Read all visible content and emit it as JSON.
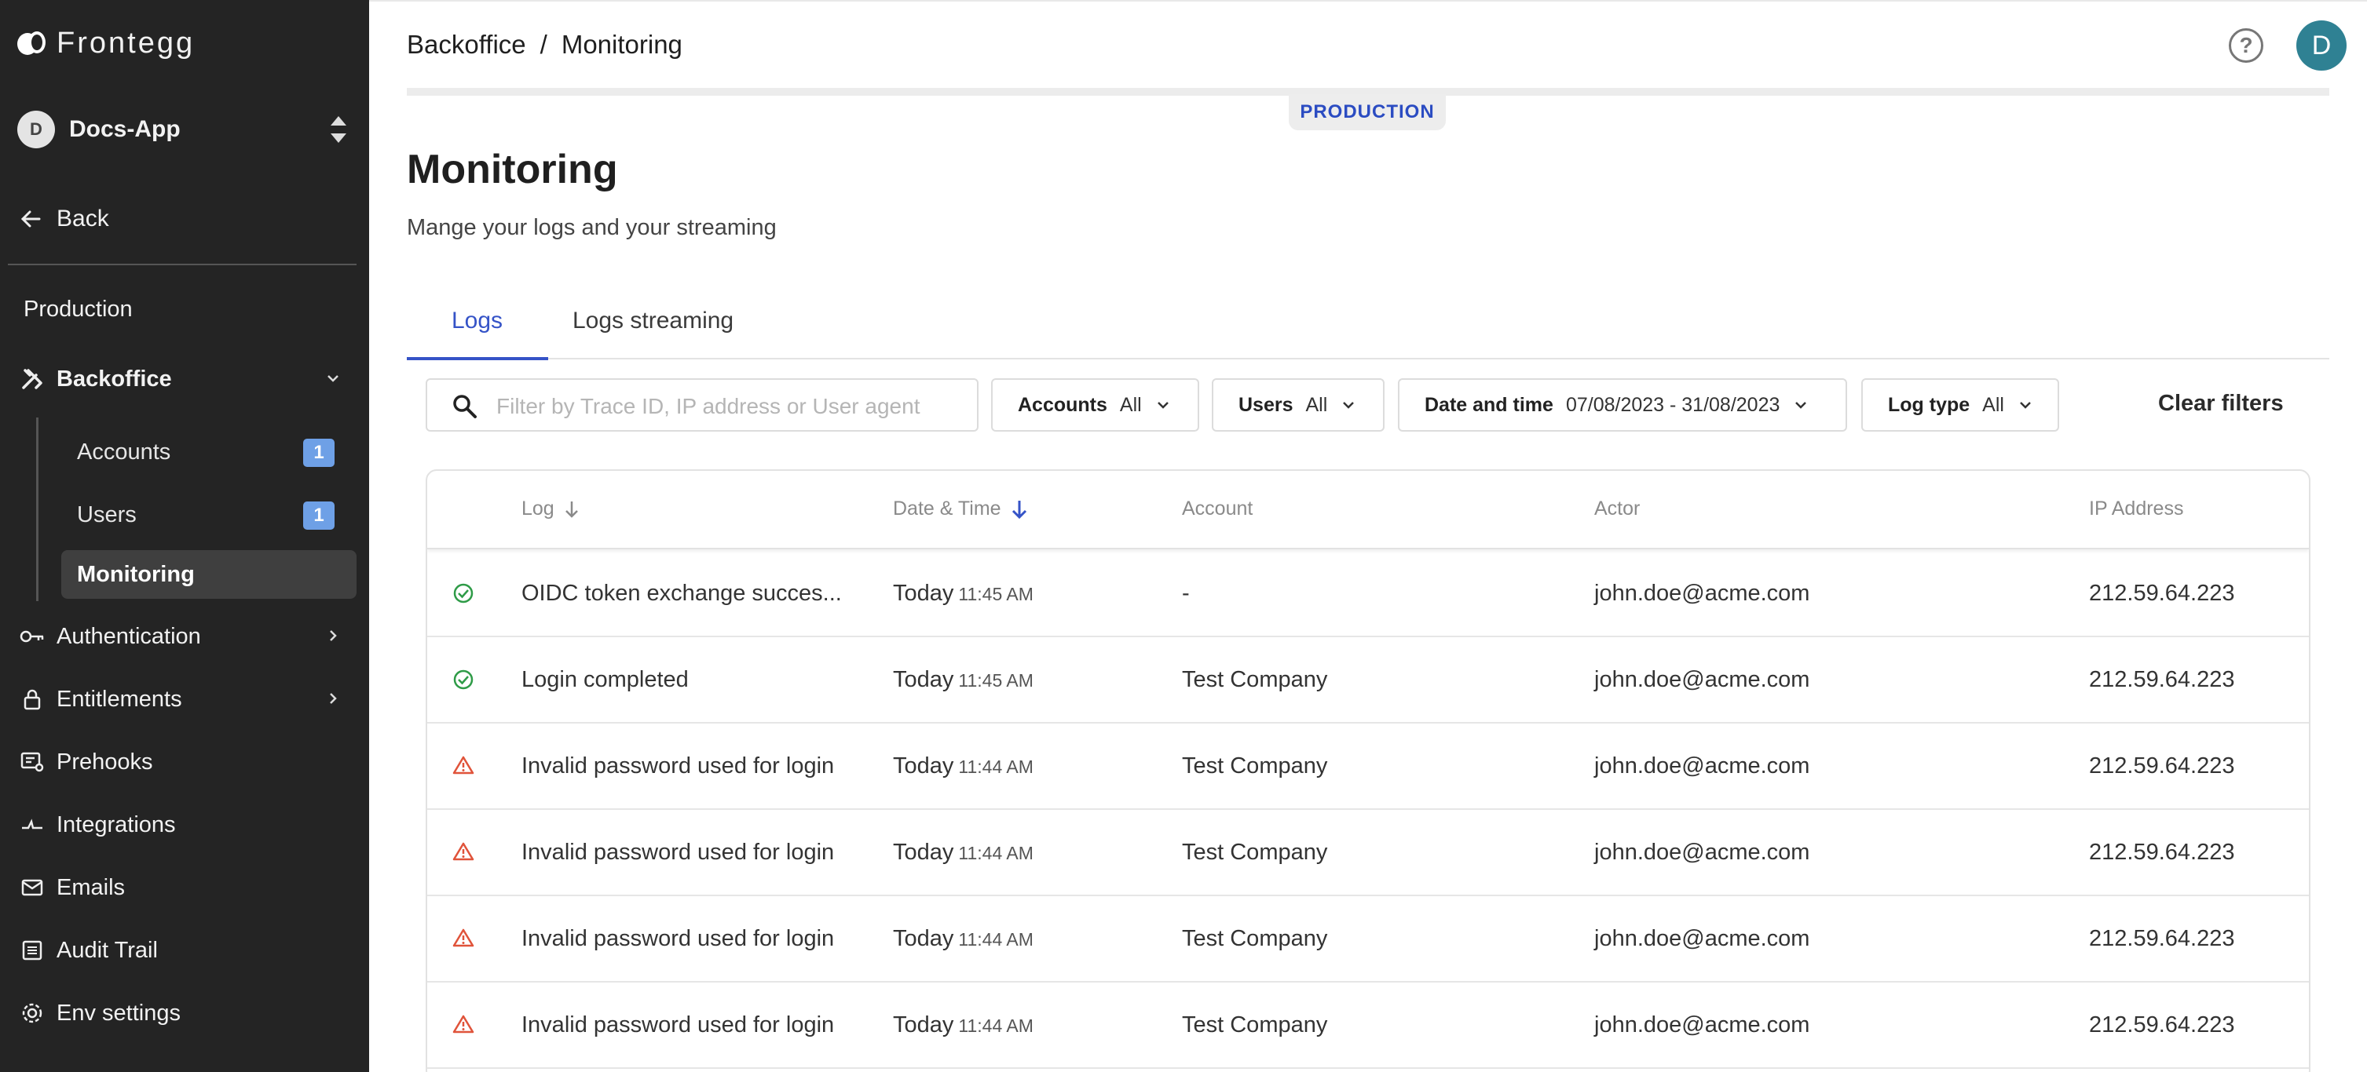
{
  "brand": {
    "name": "Frontegg"
  },
  "app": {
    "initial": "D",
    "name": "Docs-App"
  },
  "sidebar": {
    "back_label": "Back",
    "env_label": "Production",
    "backoffice_label": "Backoffice",
    "sub_items": [
      {
        "label": "Accounts",
        "badge": "1"
      },
      {
        "label": "Users",
        "badge": "1"
      },
      {
        "label": "Monitoring",
        "badge": ""
      }
    ],
    "items": [
      {
        "label": "Authentication"
      },
      {
        "label": "Entitlements"
      },
      {
        "label": "Prehooks"
      },
      {
        "label": "Integrations"
      },
      {
        "label": "Emails"
      },
      {
        "label": "Audit Trail"
      },
      {
        "label": "Env settings"
      }
    ]
  },
  "header": {
    "breadcrumb": [
      "Backoffice",
      "/",
      "Monitoring"
    ],
    "help_glyph": "?",
    "user_initial": "D",
    "env_badge": "PRODUCTION"
  },
  "page": {
    "title": "Monitoring",
    "subtitle": "Mange your logs and your streaming"
  },
  "tabs": [
    {
      "label": "Logs",
      "active": true
    },
    {
      "label": "Logs streaming",
      "active": false
    }
  ],
  "filters": {
    "search_placeholder": "Filter by Trace ID, IP address or User agent",
    "accounts": {
      "label": "Accounts",
      "value": "All"
    },
    "users": {
      "label": "Users",
      "value": "All"
    },
    "date": {
      "label": "Date and time",
      "value": "07/08/2023 - 31/08/2023"
    },
    "log_type": {
      "label": "Log type",
      "value": "All"
    },
    "clear_label": "Clear filters"
  },
  "table": {
    "columns": [
      "Log",
      "Date & Time",
      "Account",
      "Actor",
      "IP Address"
    ],
    "rows": [
      {
        "status": "success",
        "log": "OIDC token exchange succes...",
        "day": "Today",
        "time": "11:45 AM",
        "account": "-",
        "actor": "john.doe@acme.com",
        "ip": "212.59.64.223"
      },
      {
        "status": "success",
        "log": "Login completed",
        "day": "Today",
        "time": "11:45 AM",
        "account": "Test Company",
        "actor": "john.doe@acme.com",
        "ip": "212.59.64.223"
      },
      {
        "status": "warning",
        "log": "Invalid password used for login",
        "day": "Today",
        "time": "11:44 AM",
        "account": "Test Company",
        "actor": "john.doe@acme.com",
        "ip": "212.59.64.223"
      },
      {
        "status": "warning",
        "log": "Invalid password used for login",
        "day": "Today",
        "time": "11:44 AM",
        "account": "Test Company",
        "actor": "john.doe@acme.com",
        "ip": "212.59.64.223"
      },
      {
        "status": "warning",
        "log": "Invalid password used for login",
        "day": "Today",
        "time": "11:44 AM",
        "account": "Test Company",
        "actor": "john.doe@acme.com",
        "ip": "212.59.64.223"
      },
      {
        "status": "warning",
        "log": "Invalid password used for login",
        "day": "Today",
        "time": "11:44 AM",
        "account": "Test Company",
        "actor": "john.doe@acme.com",
        "ip": "212.59.64.223"
      }
    ]
  },
  "colors": {
    "accent": "#3553c7",
    "sidebar_bg": "#242424",
    "success": "#2e9b47",
    "warning": "#e0533a",
    "badge": "#6ea0e6"
  }
}
